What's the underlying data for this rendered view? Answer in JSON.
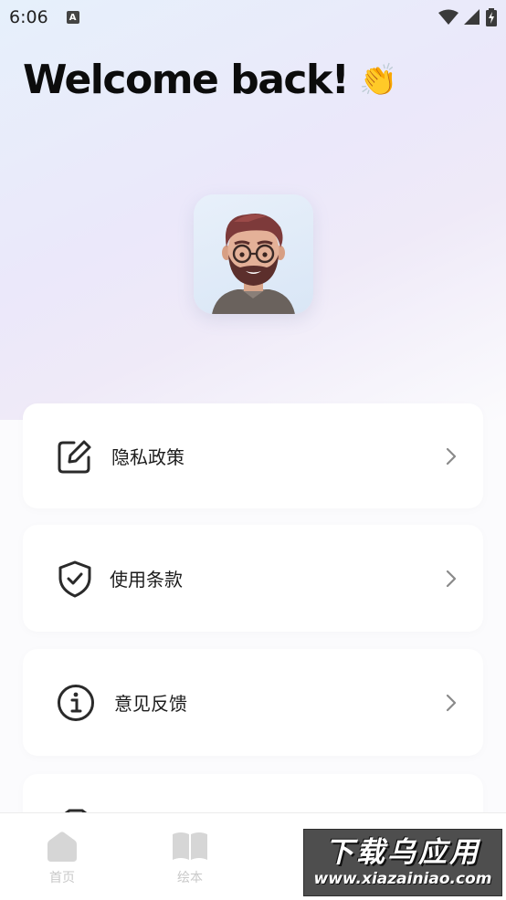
{
  "status_bar": {
    "time": "6:06",
    "notification_icon": "a-icon",
    "icons": [
      "wifi-icon",
      "signal-icon",
      "battery-charging-icon"
    ]
  },
  "header": {
    "title": "Welcome back!",
    "emoji_icon": "waving-hands-icon"
  },
  "profile": {
    "avatar_icon": "memoji-avatar-icon"
  },
  "menu": {
    "items": [
      {
        "label": "隐私政策",
        "icon": "edit-icon"
      },
      {
        "label": "使用条款",
        "icon": "shield-check-icon"
      },
      {
        "label": "意见反馈",
        "icon": "info-icon"
      },
      {
        "label": "",
        "icon": "partial-icon"
      }
    ],
    "chevron_icon": "chevron-right-icon"
  },
  "bottom_nav": {
    "items": [
      {
        "label": "首页",
        "icon": "home-icon"
      },
      {
        "label": "绘本",
        "icon": "book-icon"
      }
    ]
  },
  "watermark": {
    "title": "下载乌应用",
    "url": "www.xiazainiao.com"
  },
  "colors": {
    "text_primary": "#0c0c0c",
    "nav_inactive": "#c9c9c9",
    "card_bg": "#ffffff"
  }
}
